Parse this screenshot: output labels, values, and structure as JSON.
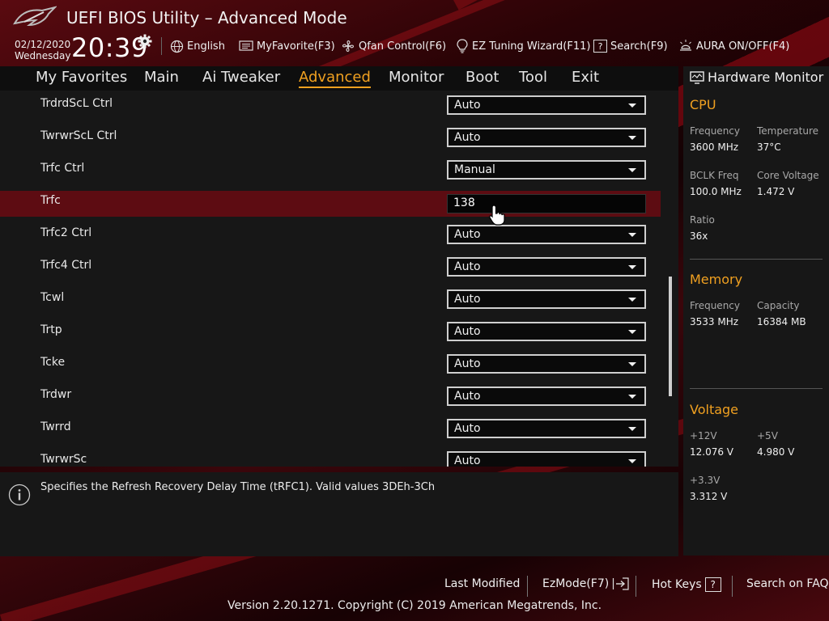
{
  "header": {
    "title": "UEFI BIOS Utility – Advanced Mode",
    "date": "02/12/2020",
    "weekday": "Wednesday",
    "time": "20:39",
    "buttons": {
      "language": "English",
      "myfavorite": "MyFavorite(F3)",
      "qfan": "Qfan Control(F6)",
      "eztuning": "EZ Tuning Wizard(F11)",
      "search": "Search(F9)",
      "aura": "AURA ON/OFF(F4)"
    }
  },
  "nav": {
    "tabs": [
      "My Favorites",
      "Main",
      "Ai Tweaker",
      "Advanced",
      "Monitor",
      "Boot",
      "Tool",
      "Exit"
    ],
    "active": "Advanced"
  },
  "settings": [
    {
      "label": "TrdrdScL Ctrl",
      "value": "Auto"
    },
    {
      "label": "TwrwrScL Ctrl",
      "value": "Auto"
    },
    {
      "label": "Trfc Ctrl",
      "value": "Manual"
    },
    {
      "label": "Trfc",
      "value": "138"
    },
    {
      "label": "Trfc2 Ctrl",
      "value": "Auto"
    },
    {
      "label": "Trfc4 Ctrl",
      "value": "Auto"
    },
    {
      "label": "Tcwl",
      "value": "Auto"
    },
    {
      "label": "Trtp",
      "value": "Auto"
    },
    {
      "label": "Tcke",
      "value": "Auto"
    },
    {
      "label": "Trdwr",
      "value": "Auto"
    },
    {
      "label": "Twrrd",
      "value": "Auto"
    },
    {
      "label": "TwrwrSc",
      "value": "Auto"
    }
  ],
  "help": {
    "text": "Specifies the Refresh Recovery Delay Time (tRFC1). Valid values 3DEh-3Ch"
  },
  "hardware_monitor": {
    "title": "Hardware Monitor",
    "cpu": {
      "heading": "CPU",
      "frequency_label": "Frequency",
      "frequency": "3600 MHz",
      "temperature_label": "Temperature",
      "temperature": "37°C",
      "bclk_label": "BCLK Freq",
      "bclk": "100.0 MHz",
      "core_voltage_label": "Core Voltage",
      "core_voltage": "1.472 V",
      "ratio_label": "Ratio",
      "ratio": "36x"
    },
    "memory": {
      "heading": "Memory",
      "frequency_label": "Frequency",
      "frequency": "3533 MHz",
      "capacity_label": "Capacity",
      "capacity": "16384 MB"
    },
    "voltage": {
      "heading": "Voltage",
      "v12_label": "+12V",
      "v12": "12.076 V",
      "v5_label": "+5V",
      "v5": "4.980 V",
      "v33_label": "+3.3V",
      "v33": "3.312 V"
    }
  },
  "footer": {
    "last_modified": "Last Modified",
    "ezmode": "EzMode(F7)",
    "hotkeys": "Hot Keys",
    "hotkeys_key": "?",
    "faq": "Search on FAQ",
    "copyright": "Version 2.20.1271. Copyright (C) 2019 American Megatrends, Inc."
  },
  "colors": {
    "accent": "#f0a020",
    "selected_row": "#5d0c12",
    "panel": "#171717"
  }
}
